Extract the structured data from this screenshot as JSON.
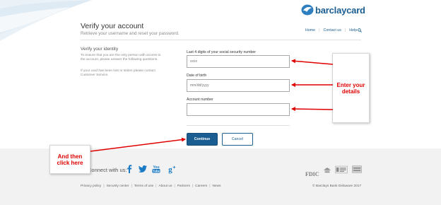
{
  "brand": {
    "logo_text": "barclaycard",
    "color": "#1a5e91"
  },
  "header": {
    "title": "Verify your account",
    "subtitle": "Retrieve your username and reset your password.",
    "nav": {
      "home": "Home",
      "contact": "Contact us",
      "help": "Help"
    }
  },
  "identity": {
    "title": "Verify your identity",
    "desc1": "To ensure that you are the only person with access to the account, please answer the following questions.",
    "desc2": "If your card has been lost or stolen please contact Customer Service."
  },
  "form": {
    "ssn_label": "Last 4 digits of your social security number",
    "ssn_placeholder": "xxxx",
    "dob_label": "Date of birth",
    "dob_placeholder": "mm/dd/yyyy",
    "account_label": "Account number",
    "account_placeholder": "",
    "continue_label": "Continue",
    "cancel_label": "Cancel"
  },
  "footer": {
    "connect_label": "Connect with us:",
    "links": [
      "Privacy policy",
      "Security center",
      "Terms of use",
      "About us",
      "Partners",
      "Careers",
      "News"
    ],
    "copyright": "© Barclays Bank Delaware 2017",
    "fdic": "FDIC"
  },
  "annotations": {
    "right_callout": "Enter your details",
    "left_callout": "And then click here",
    "color": "#e00000"
  }
}
